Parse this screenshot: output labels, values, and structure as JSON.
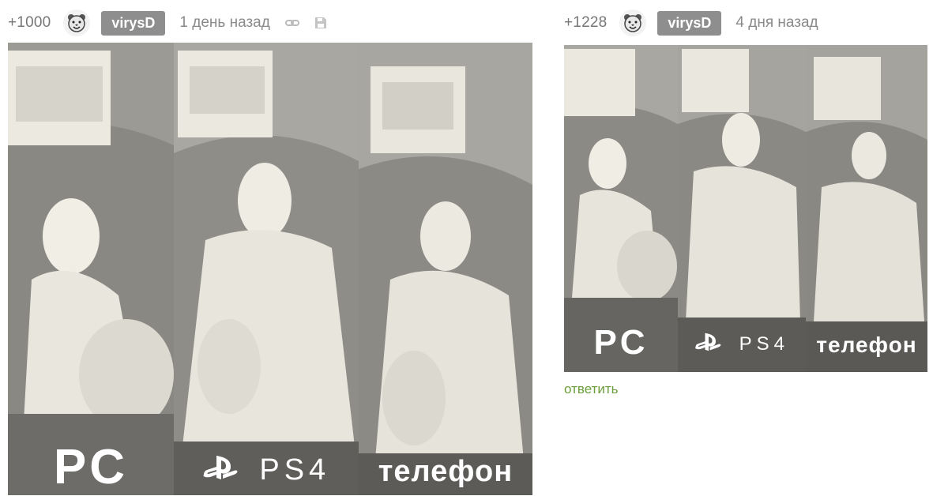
{
  "comments": [
    {
      "rating": "+1000",
      "author": "virysD",
      "time": "1 день назад",
      "icons": [
        "link-icon",
        "save-icon"
      ],
      "image": {
        "panels": [
          {
            "label": "PC"
          },
          {
            "label": "PS4"
          },
          {
            "label": "телефон"
          }
        ]
      }
    },
    {
      "rating": "+1228",
      "author": "virysD",
      "time": "4 дня назад",
      "reply": "ответить",
      "image": {
        "panels": [
          {
            "label": "PC"
          },
          {
            "label": "PS4"
          },
          {
            "label": "телефон"
          }
        ]
      }
    }
  ],
  "colors": {
    "nick_bg": "#8e8e8e",
    "reply": "#6a9e3a",
    "muted_text": "#8a8a8a"
  }
}
